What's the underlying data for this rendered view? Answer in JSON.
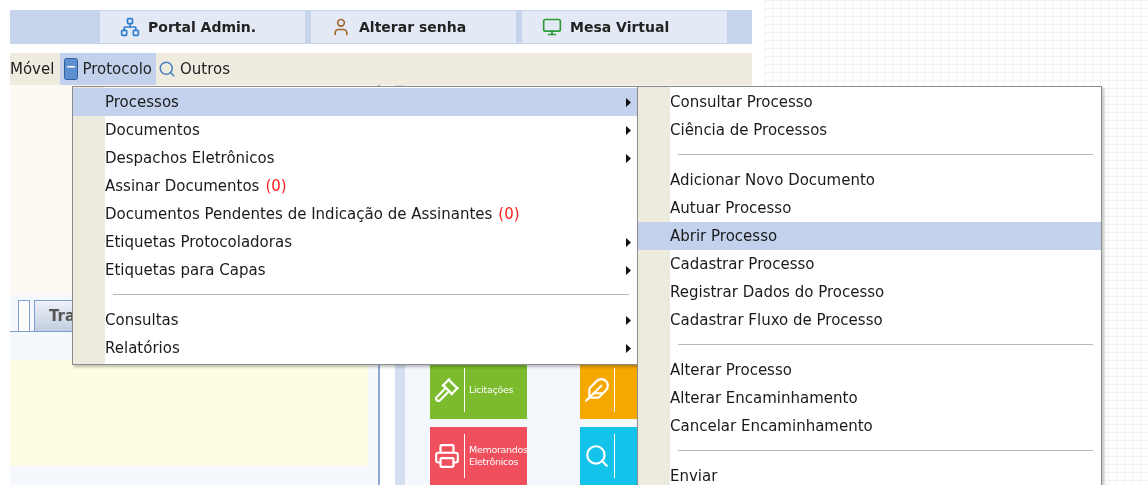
{
  "top_buttons": [
    {
      "label": "Portal Admin.",
      "kind": "network"
    },
    {
      "label": "Alterar senha",
      "kind": "user"
    },
    {
      "label": "Mesa Virtual",
      "kind": "monitor"
    }
  ],
  "menu_bar": [
    {
      "label": "Móvel",
      "kind": "plain",
      "selected": false
    },
    {
      "label": "Protocolo",
      "kind": "document",
      "selected": true
    },
    {
      "label": "Outros",
      "kind": "search",
      "selected": false
    }
  ],
  "tab": {
    "label": "Tra"
  },
  "tiles": [
    {
      "label": "Licitações",
      "kind": "gavel",
      "color": "#7cbb2d"
    },
    {
      "kind": "quill",
      "color": "#f5a800"
    },
    {
      "label": "Memorandos Eletrônicos",
      "kind": "printer",
      "color": "#f0505e"
    },
    {
      "kind": "search",
      "color": "#14c3ea"
    }
  ],
  "menu": [
    {
      "kind": "item",
      "label": "Processos",
      "selected": true,
      "has_submenu": true
    },
    {
      "kind": "item",
      "label": "Documentos",
      "selected": false,
      "has_submenu": true
    },
    {
      "kind": "item",
      "label": "Despachos Eletrônicos",
      "selected": false,
      "has_submenu": true
    },
    {
      "kind": "item",
      "label": "Assinar Documentos",
      "count": "(0)",
      "selected": false,
      "has_submenu": false
    },
    {
      "kind": "item",
      "label": "Documentos Pendentes de Indicação de Assinantes",
      "count": "(0)",
      "selected": false,
      "has_submenu": false
    },
    {
      "kind": "item",
      "label": "Etiquetas Protocoladoras",
      "selected": false,
      "has_submenu": true
    },
    {
      "kind": "item",
      "label": "Etiquetas para Capas",
      "selected": false,
      "has_submenu": true
    },
    {
      "kind": "separator"
    },
    {
      "kind": "item",
      "label": "Consultas",
      "selected": false,
      "has_submenu": true
    },
    {
      "kind": "item",
      "label": "Relatórios",
      "selected": false,
      "has_submenu": true
    }
  ],
  "submenu": [
    {
      "kind": "item",
      "label": "Consultar Processo",
      "selected": false
    },
    {
      "kind": "item",
      "label": "Ciência de Processos",
      "selected": false
    },
    {
      "kind": "separator"
    },
    {
      "kind": "item",
      "label": "Adicionar Novo Documento",
      "selected": false
    },
    {
      "kind": "item",
      "label": "Autuar Processo",
      "selected": false
    },
    {
      "kind": "item",
      "label": "Abrir Processo",
      "selected": true
    },
    {
      "kind": "item",
      "label": "Cadastrar Processo",
      "selected": false
    },
    {
      "kind": "item",
      "label": "Registrar Dados do Processo",
      "selected": false
    },
    {
      "kind": "item",
      "label": "Cadastrar Fluxo de Processo",
      "selected": false
    },
    {
      "kind": "separator"
    },
    {
      "kind": "item",
      "label": "Alterar Processo",
      "selected": false
    },
    {
      "kind": "item",
      "label": "Alterar Encaminhamento",
      "selected": false
    },
    {
      "kind": "item",
      "label": "Cancelar Encaminhamento",
      "selected": false
    },
    {
      "kind": "separator"
    },
    {
      "kind": "item",
      "label": "Enviar",
      "selected": false
    }
  ]
}
